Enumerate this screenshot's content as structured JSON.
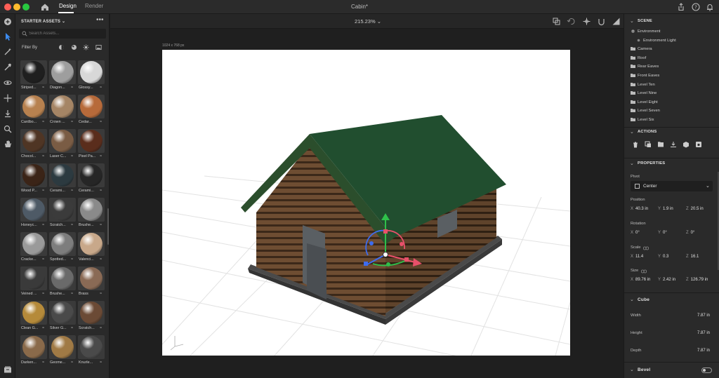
{
  "titlebar": {
    "doc_title": "Cabin*",
    "tabs": [
      {
        "label": "Design",
        "active": true
      },
      {
        "label": "Render",
        "active": false
      }
    ]
  },
  "assets_panel": {
    "header": "STARTER ASSETS",
    "more_label": "•••",
    "search_placeholder": "Search Assets...",
    "filter_label": "Filter By",
    "items": [
      {
        "label": "Striped...",
        "color": "#1f1f1f"
      },
      {
        "label": "Diagon...",
        "color": "#9e9e9e"
      },
      {
        "label": "Glossy...",
        "color": "#d8d8d8"
      },
      {
        "label": "Cardbo...",
        "color": "#b7814f"
      },
      {
        "label": "Crown ...",
        "color": "#a58565"
      },
      {
        "label": "Cedar...",
        "color": "#b76a3a"
      },
      {
        "label": "Chocol...",
        "color": "#4f3524"
      },
      {
        "label": "Laser C...",
        "color": "#7a5c44"
      },
      {
        "label": "Pixel Pa...",
        "color": "#5a2d1c"
      },
      {
        "label": "Wood P...",
        "color": "#3b2417"
      },
      {
        "label": "Cerami...",
        "color": "#2c3a40"
      },
      {
        "label": "Cerami...",
        "color": "#262626"
      },
      {
        "label": "Honeyc...",
        "color": "#4e5a66"
      },
      {
        "label": "Scratch...",
        "color": "#3b3b3b"
      },
      {
        "label": "Brushe...",
        "color": "#8a8a8a"
      },
      {
        "label": "Cracke...",
        "color": "#9a9a9a"
      },
      {
        "label": "Spotted...",
        "color": "#7d7d7d"
      },
      {
        "label": "Valenci...",
        "color": "#c8a88a"
      },
      {
        "label": "Veined ...",
        "color": "#3a3a3a"
      },
      {
        "label": "Brushe...",
        "color": "#6a6a6a"
      },
      {
        "label": "Brass",
        "color": "#8a6a55"
      },
      {
        "label": "Clean G...",
        "color": "#b58a3a"
      },
      {
        "label": "Silver G...",
        "color": "#4a4a4a"
      },
      {
        "label": "Scratch...",
        "color": "#6b4a35"
      },
      {
        "label": "Darken...",
        "color": "#8a6a4a"
      },
      {
        "label": "Geome...",
        "color": "#a07a45"
      },
      {
        "label": "Knurle...",
        "color": "#4a4a4a"
      }
    ]
  },
  "canvas": {
    "zoom": "215.23%",
    "dimensions": "1024 x 768 px"
  },
  "scene_panel": {
    "title": "SCENE",
    "items": [
      {
        "label": "Environment",
        "icon": "globe-icon"
      },
      {
        "label": "Environment Light",
        "icon": "light-icon"
      },
      {
        "label": "Camera",
        "icon": "folder-icon"
      },
      {
        "label": "Roof",
        "icon": "folder-icon"
      },
      {
        "label": "Rear Eaves",
        "icon": "folder-icon"
      },
      {
        "label": "Front Eaves",
        "icon": "folder-icon"
      },
      {
        "label": "Level Ten",
        "icon": "folder-icon"
      },
      {
        "label": "Level Nine",
        "icon": "folder-icon"
      },
      {
        "label": "Level Eight",
        "icon": "folder-icon"
      },
      {
        "label": "Level Seven",
        "icon": "folder-icon"
      },
      {
        "label": "Level Six",
        "icon": "folder-icon"
      }
    ]
  },
  "actions_panel": {
    "title": "ACTIONS",
    "icons": [
      "delete-icon",
      "duplicate-icon",
      "group-icon",
      "download-icon",
      "material-icon",
      "save-icon"
    ]
  },
  "properties_panel": {
    "title": "PROPERTIES",
    "pivot_label": "Pivot",
    "pivot_value": "Center",
    "position": {
      "label": "Position",
      "x": "40.3 in",
      "y": "1.9 in",
      "z": "20.5 in"
    },
    "rotation": {
      "label": "Rotation",
      "x": "0°",
      "y": "0°",
      "z": "0°"
    },
    "scale": {
      "label": "Scale",
      "x": "11.4",
      "y": "0.3",
      "z": "16.1"
    },
    "size": {
      "label": "Size",
      "x": "89.76 in",
      "y": "2.42 in",
      "z": "126.79 in"
    },
    "axes": {
      "x": "X",
      "y": "Y",
      "z": "Z"
    }
  },
  "cube_panel": {
    "title": "Cube",
    "width_label": "Width",
    "width_value": "7.87 in",
    "height_label": "Height",
    "height_value": "7.87 in",
    "depth_label": "Depth",
    "depth_value": "7.87 in"
  },
  "bevel_panel": {
    "title": "Bevel",
    "enabled": false
  },
  "colors": {
    "roof": "#1f4a2c",
    "log": "#5a3f2a",
    "gizmo_y": "#2fbf4a",
    "gizmo_x": "#e8506a",
    "gizmo_z": "#3d6cf0"
  }
}
